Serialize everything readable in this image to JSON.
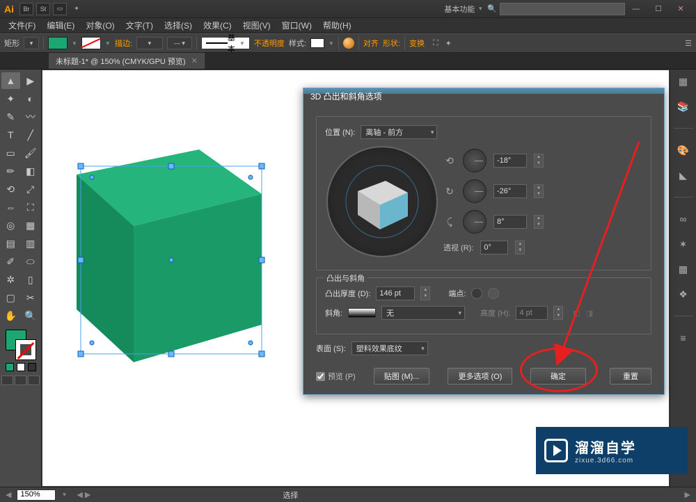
{
  "title": {
    "workspace": "基本功能",
    "search_placeholder": ""
  },
  "menu": [
    "文件(F)",
    "编辑(E)",
    "对象(O)",
    "文字(T)",
    "选择(S)",
    "效果(C)",
    "视图(V)",
    "窗口(W)",
    "帮助(H)"
  ],
  "options_bar": {
    "shape_label": "矩形",
    "stroke_label": "描边:",
    "style_label": "基本",
    "opacity_label": "不透明度",
    "stylesty_label": "样式:",
    "align_label": "对齐",
    "shape_btn": "形状:",
    "transform_label": "变换"
  },
  "tab": {
    "title": "未标题-1* @ 150% (CMYK/GPU 预览)"
  },
  "dialog": {
    "title": "3D 凸出和斜角选项",
    "position_label": "位置 (N):",
    "position_value": "离轴 - 前方",
    "rot_x": "-18°",
    "rot_y": "-26°",
    "rot_z": "8°",
    "perspective_label": "透视 (R):",
    "perspective_value": "0°",
    "section2_title": "凸出与斜角",
    "extrude_label": "凸出厚度 (D):",
    "extrude_value": "146 pt",
    "cap_label": "端点:",
    "bevel_label": "斜角:",
    "bevel_value": "无",
    "height_label": "高度 (H):",
    "height_value": "4 pt",
    "surface_label": "表面 (S):",
    "surface_value": "塑料效果底纹",
    "preview_label": "预览 (P)",
    "map_btn": "贴图 (M)...",
    "more_btn": "更多选项 (O)",
    "ok_btn": "确定",
    "reset_btn": "重置"
  },
  "status": {
    "zoom": "150%",
    "tool": "选择"
  },
  "watermark": {
    "big": "溜溜自学",
    "small": "zixue.3d66.com"
  }
}
